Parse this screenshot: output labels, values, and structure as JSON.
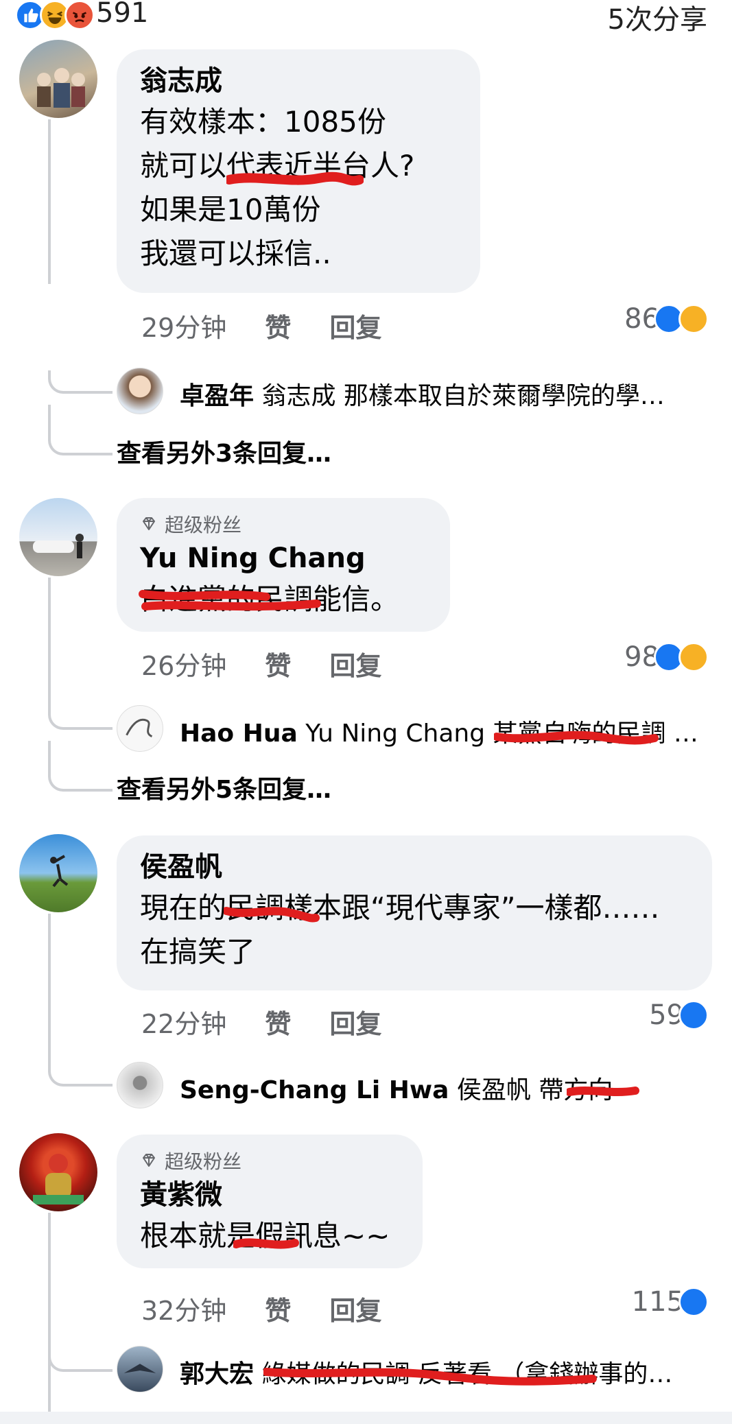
{
  "header": {
    "reaction_count": "591",
    "share_label": "5次分享"
  },
  "colors": {
    "like_blue": "#1877f2",
    "bubble_bg": "#f0f2f5",
    "meta_gray": "#65676b",
    "redaction_red": "#e01e1e"
  },
  "comments": [
    {
      "author": "翁志成",
      "text": "有效樣本：1085份\n就可以代表近半台人?\n如果是10萬份\n我還可以採信..",
      "time": "29分钟",
      "like": "赞",
      "reply": "回复",
      "reactions": "86",
      "reaction_icons": [
        "like-icon",
        "haha-icon"
      ],
      "preview_reply": {
        "name": "卓盈年",
        "text": "翁志成 那樣本取自於萊爾學院的學…"
      },
      "more_replies": "查看另外3条回复…"
    },
    {
      "badge": "超级粉丝",
      "author": "Yu Ning Chang",
      "text": "白進黨的民調能信。",
      "time": "26分钟",
      "like": "赞",
      "reply": "回复",
      "reactions": "98",
      "reaction_icons": [
        "like-icon",
        "haha-icon"
      ],
      "preview_reply": {
        "name": "Hao Hua",
        "text": "Yu Ning Chang 某黨自嗨的民調  …"
      },
      "more_replies": "查看另外5条回复…"
    },
    {
      "author": "侯盈帆",
      "text": "現在的民調樣本跟“現代專家”一樣都……\n在搞笑了",
      "time": "22分钟",
      "like": "赞",
      "reply": "回复",
      "reactions": "59",
      "reaction_icons": [
        "like-icon"
      ],
      "preview_reply": {
        "name": "Seng-Chang Li Hwa",
        "text": "侯盈帆 帶方向"
      }
    },
    {
      "badge": "超级粉丝",
      "author": "黃紫微",
      "text": "根本就是假訊息~~",
      "time": "32分钟",
      "like": "赞",
      "reply": "回复",
      "reactions": "115",
      "reaction_icons": [
        "like-icon"
      ],
      "preview_reply": {
        "name": "郭大宏",
        "text": "綠媒做的民調 反著看 （拿錢辦事的…"
      }
    }
  ]
}
